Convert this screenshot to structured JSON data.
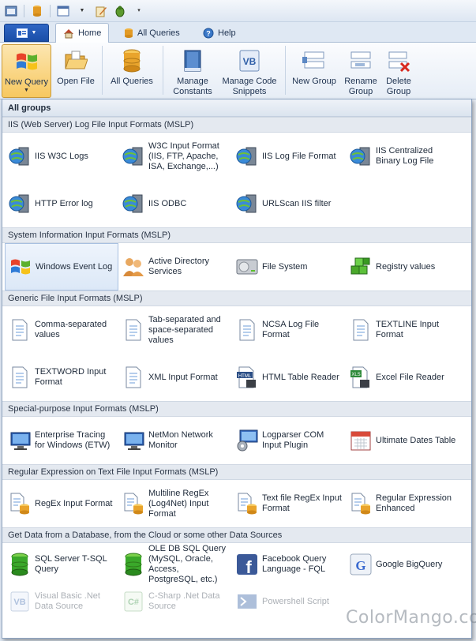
{
  "qat": {
    "icons": [
      "app-window-icon",
      "database-icon",
      "window-icon",
      "edit-icon",
      "bug-icon",
      "customize-icon"
    ]
  },
  "tabs": [
    {
      "label": "Home",
      "icon": "home-icon",
      "active": true
    },
    {
      "label": "All Queries",
      "icon": "database-icon",
      "active": false
    },
    {
      "label": "Help",
      "icon": "help-icon",
      "active": false
    }
  ],
  "ribbon": {
    "new_query": "New Query",
    "open_file": "Open File",
    "all_queries": "All Queries",
    "manage_constants": "Manage Constants",
    "manage_snippets": "Manage Code Snippets",
    "new_group": "New Group",
    "rename_group": "Rename Group",
    "delete_group": "Delete Group"
  },
  "gallery": {
    "title": "All groups",
    "sections": [
      {
        "header": "IIS (Web Server) Log File Input Formats (MSLP)",
        "items": [
          "IIS W3C Logs",
          "W3C Input Format (IIS, FTP, Apache, ISA, Exchange,...)",
          "IIS Log File Format",
          "IIS Centralized Binary Log File",
          "HTTP Error log",
          "IIS ODBC",
          "URLScan IIS filter"
        ]
      },
      {
        "header": "System Information Input Formats (MSLP)",
        "items": [
          "Windows Event Log",
          "Active Directory Services",
          "File System",
          "Registry values"
        ]
      },
      {
        "header": "Generic File Input Formats (MSLP)",
        "items": [
          "Comma-separated values",
          "Tab-separated and space-separated values",
          "NCSA Log File Format",
          "TEXTLINE Input Format",
          "TEXTWORD Input Format",
          "XML Input Format",
          "HTML Table Reader",
          "Excel File Reader"
        ]
      },
      {
        "header": "Special-purpose Input Formats (MSLP)",
        "items": [
          "Enterprise Tracing for Windows (ETW)",
          "NetMon Network Monitor",
          "Logparser COM Input Plugin",
          "Ultimate Dates Table"
        ]
      },
      {
        "header": "Regular Expression on Text File Input Formats (MSLP)",
        "items": [
          "RegEx Input Format",
          "Multiline RegEx (Log4Net) Input Format",
          "Text file RegEx Input Format",
          "Regular Expression Enhanced"
        ]
      },
      {
        "header": "Get Data from a Database, from the Cloud or some other Data Sources",
        "items": [
          "SQL Server T-SQL Query",
          "OLE DB SQL Query (MySQL, Oracle, Access, PostgreSQL, etc.)",
          "Facebook Query Language - FQL",
          "Google BigQuery"
        ]
      }
    ],
    "more_items": [
      "Visual Basic .Net Data Source",
      "C-Sharp .Net Data Source",
      "Powershell Script"
    ]
  },
  "watermark": "ColorMango.com",
  "colors": {
    "accent": "#1a4ea8",
    "highlight": "#dce8f7",
    "pressed": "#f7c860"
  }
}
